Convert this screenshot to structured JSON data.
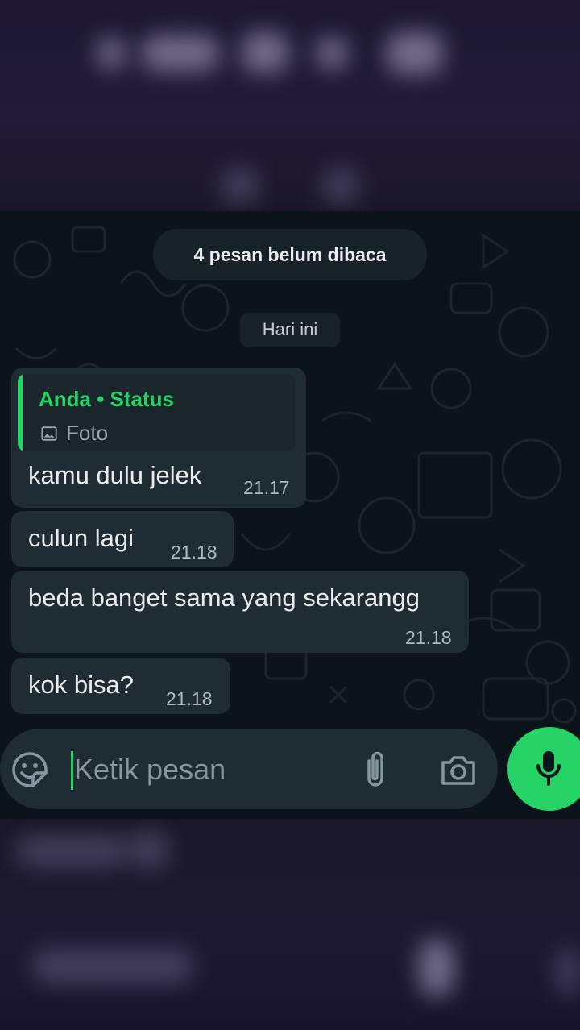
{
  "chat": {
    "unread_banner": "4 pesan belum dibaca",
    "date_chip": "Hari ini",
    "quote": {
      "title": "Anda • Status",
      "subtitle": "Foto",
      "icon": "image-icon"
    },
    "messages": [
      {
        "text": "kamu dulu jelek",
        "time": "21.17"
      },
      {
        "text": "culun lagi",
        "time": "21.18"
      },
      {
        "text": "beda banget sama yang sekarangg",
        "time": "21.18"
      },
      {
        "text": "kok bisa?",
        "time": "21.18"
      }
    ]
  },
  "composer": {
    "placeholder": "Ketik pesan",
    "icons": [
      "sticker-icon",
      "attach-icon",
      "camera-icon",
      "mic-icon"
    ]
  },
  "colors": {
    "accent": "#25d366",
    "chat_background": "#0b141a",
    "bubble": "#202c33",
    "composer": "#1f2c33"
  }
}
